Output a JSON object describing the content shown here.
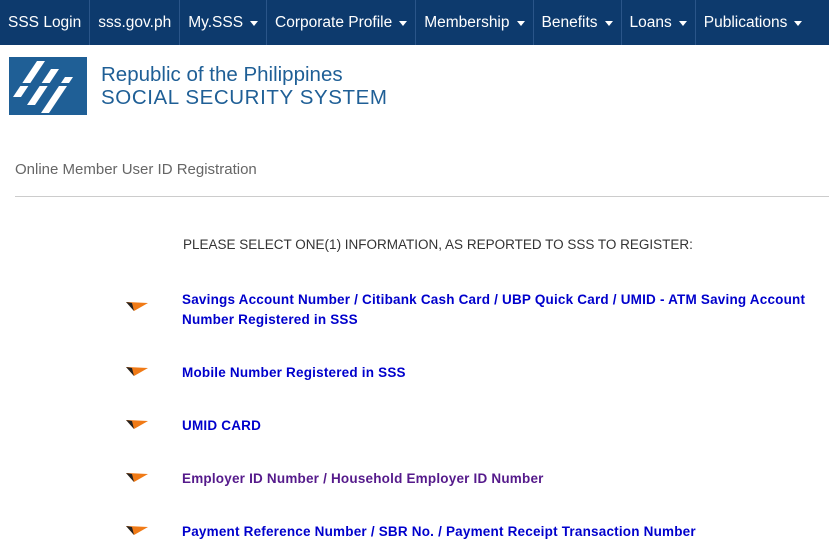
{
  "nav": {
    "items": [
      {
        "label": "SSS Login",
        "dropdown": false
      },
      {
        "label": "sss.gov.ph",
        "dropdown": false
      },
      {
        "label": "My.SSS",
        "dropdown": true
      },
      {
        "label": "Corporate Profile",
        "dropdown": true
      },
      {
        "label": "Membership",
        "dropdown": true
      },
      {
        "label": "Benefits",
        "dropdown": true
      },
      {
        "label": "Loans",
        "dropdown": true
      },
      {
        "label": "Publications",
        "dropdown": true
      }
    ]
  },
  "logo": {
    "line1": "Republic of the Philippines",
    "line2": "SOCIAL SECURITY SYSTEM"
  },
  "page": {
    "title": "Online Member User ID Registration",
    "instruction": "PLEASE SELECT ONE(1) INFORMATION, AS REPORTED TO SSS TO REGISTER:"
  },
  "options": [
    {
      "label": "Savings Account Number / Citibank Cash Card / UBP Quick Card / UMID - ATM Saving Account Number Registered in SSS",
      "visited": false
    },
    {
      "label": "Mobile Number Registered in SSS",
      "visited": false
    },
    {
      "label": "UMID CARD",
      "visited": false
    },
    {
      "label": "Employer ID Number / Household Employer ID Number",
      "visited": true
    },
    {
      "label": "Payment Reference Number / SBR No. / Payment Receipt Transaction Number",
      "visited": false
    }
  ],
  "colors": {
    "nav_bg": "#0d3a6d",
    "logo_blue": "#1f5f96",
    "link": "#0000cc",
    "link_visited": "#551a8b",
    "bullet_orange": "#f07a16"
  }
}
